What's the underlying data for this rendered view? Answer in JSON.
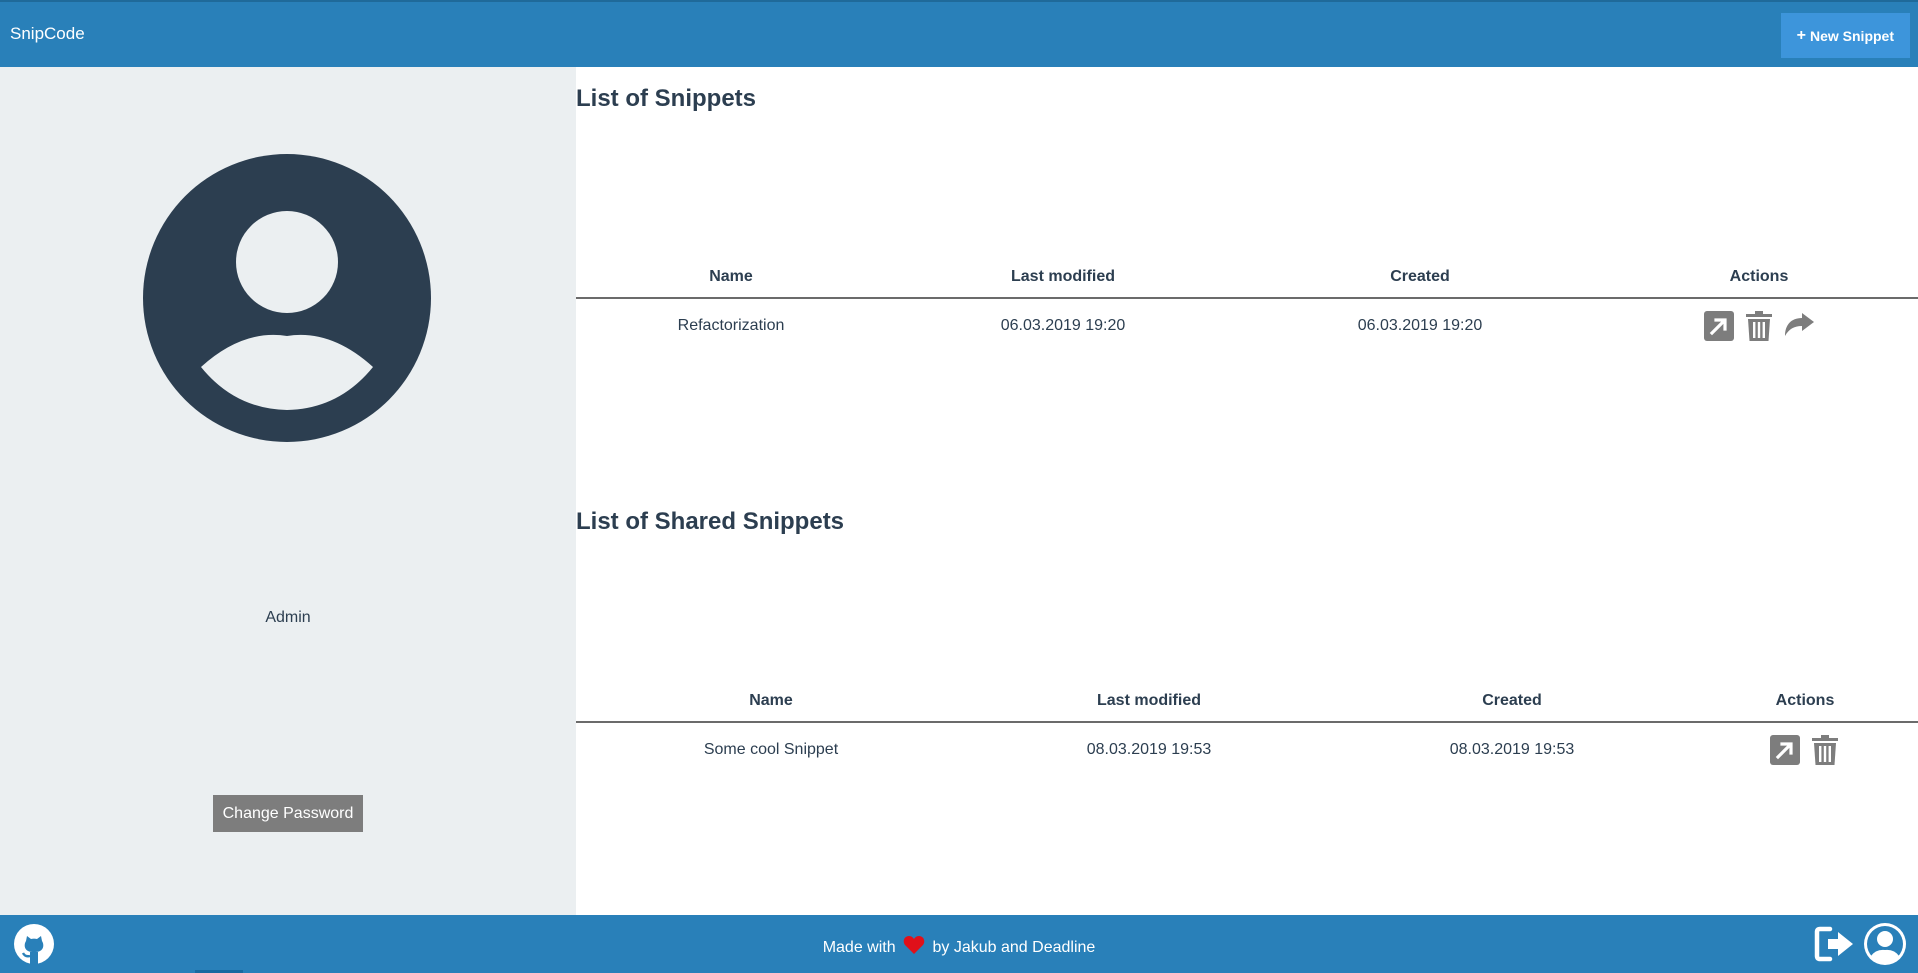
{
  "header": {
    "brand": "SnipCode",
    "new_snippet_label": "New Snippet"
  },
  "sidebar": {
    "username": "Admin",
    "change_password_label": "Change Password"
  },
  "snippets": {
    "title": "List of Snippets",
    "columns": [
      "Name",
      "Last modified",
      "Created",
      "Actions"
    ],
    "rows": [
      {
        "name": "Refactorization",
        "modified": "06.03.2019 19:20",
        "created": "06.03.2019 19:20",
        "actions": [
          "open-icon",
          "trash-icon",
          "share-icon"
        ]
      }
    ]
  },
  "shared": {
    "title": "List of Shared Snippets",
    "columns": [
      "Name",
      "Last modified",
      "Created",
      "Actions"
    ],
    "rows": [
      {
        "name": "Some cool Snippet",
        "modified": "08.03.2019 19:53",
        "created": "08.03.2019 19:53",
        "actions": [
          "open-icon",
          "trash-icon"
        ]
      }
    ]
  },
  "footer": {
    "made_with": "Made with",
    "by_text": "by Jakub and Deadline"
  },
  "colors": {
    "primary": "#2980b9",
    "button_accent": "#3d95db",
    "sidebar_bg": "#ebeff1",
    "text": "#2c3e50",
    "icon_gray": "#7d7d7d",
    "heart": "#e0101a"
  },
  "icons": [
    "plus-icon",
    "avatar-icon",
    "open-icon",
    "trash-icon",
    "share-icon",
    "github-icon",
    "heart-icon",
    "logout-icon",
    "user-icon"
  ]
}
